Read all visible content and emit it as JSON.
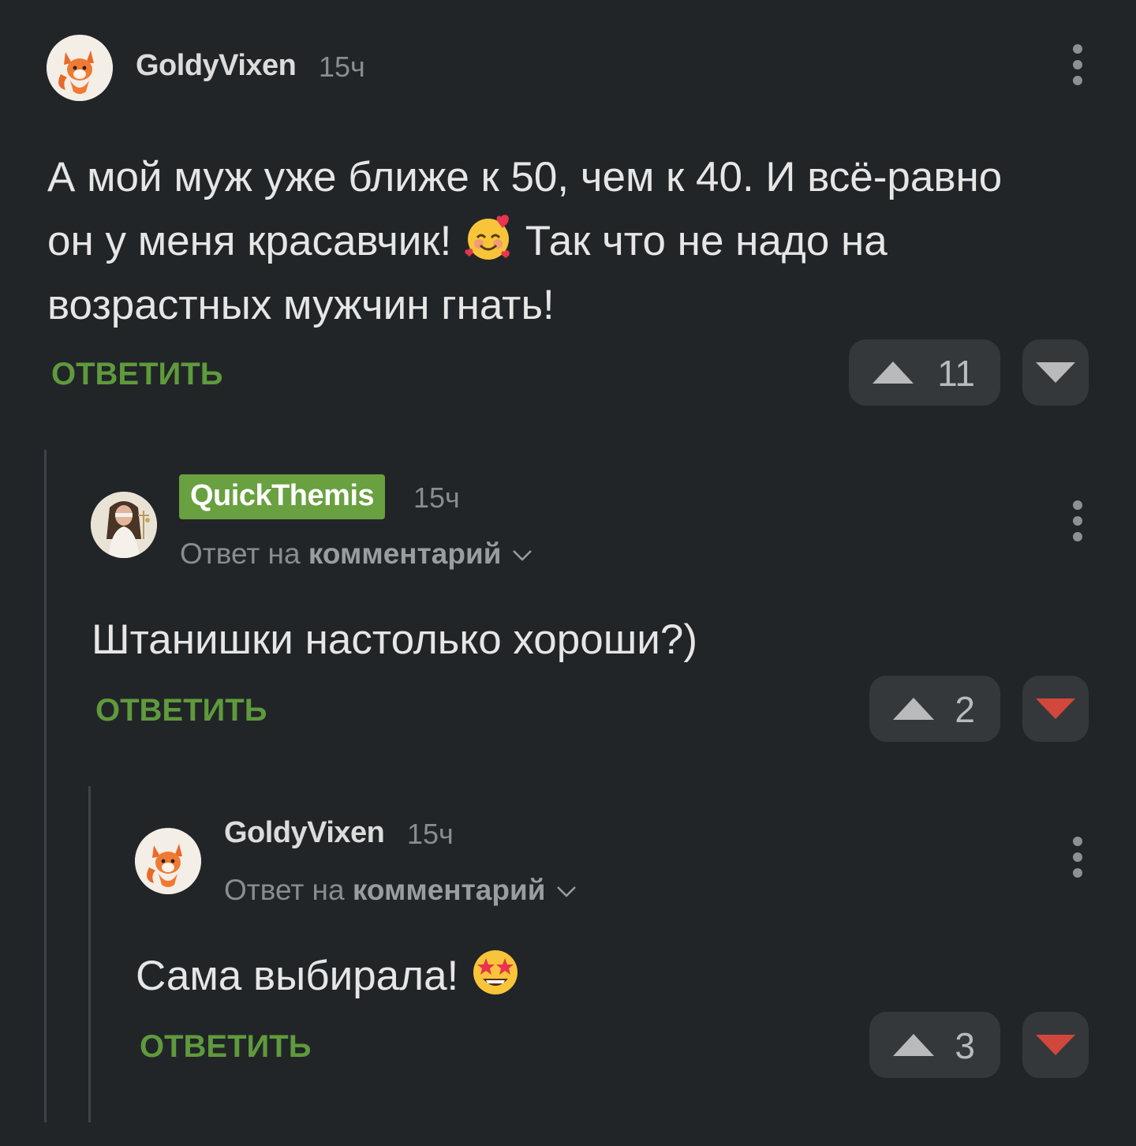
{
  "comments": [
    {
      "username": "GoldyVixen",
      "time": "15ч",
      "text_lines": [
        "А мой муж уже ближе к 50, чем к 40. И всё-равно",
        "он у меня красавчик!",
        "Так что не надо на",
        "возрастных мужчин гнать!"
      ],
      "inline_emoji": "smiling-face-with-hearts",
      "reply_label": "ОТВЕТИТЬ",
      "upvotes": "11",
      "downvoted": false
    },
    {
      "username": "QuickThemis",
      "time": "15ч",
      "reply_prefix": "Ответ на",
      "reply_target": "комментарий",
      "text": "Штанишки настолько хороши?)",
      "reply_label": "ОТВЕТИТЬ",
      "upvotes": "2",
      "downvoted": true
    },
    {
      "username": "GoldyVixen",
      "time": "15ч",
      "reply_prefix": "Ответ на",
      "reply_target": "комментарий",
      "text": "Сама выбирала!",
      "inline_emoji": "star-struck",
      "reply_label": "ОТВЕТИТЬ",
      "upvotes": "3",
      "downvoted": true
    }
  ],
  "colors": {
    "background": "#222528",
    "reply_green": "#5f9a3c",
    "username_highlight": "#69a040",
    "downvote_active": "#d2473c",
    "vote_bg": "#34383b"
  }
}
